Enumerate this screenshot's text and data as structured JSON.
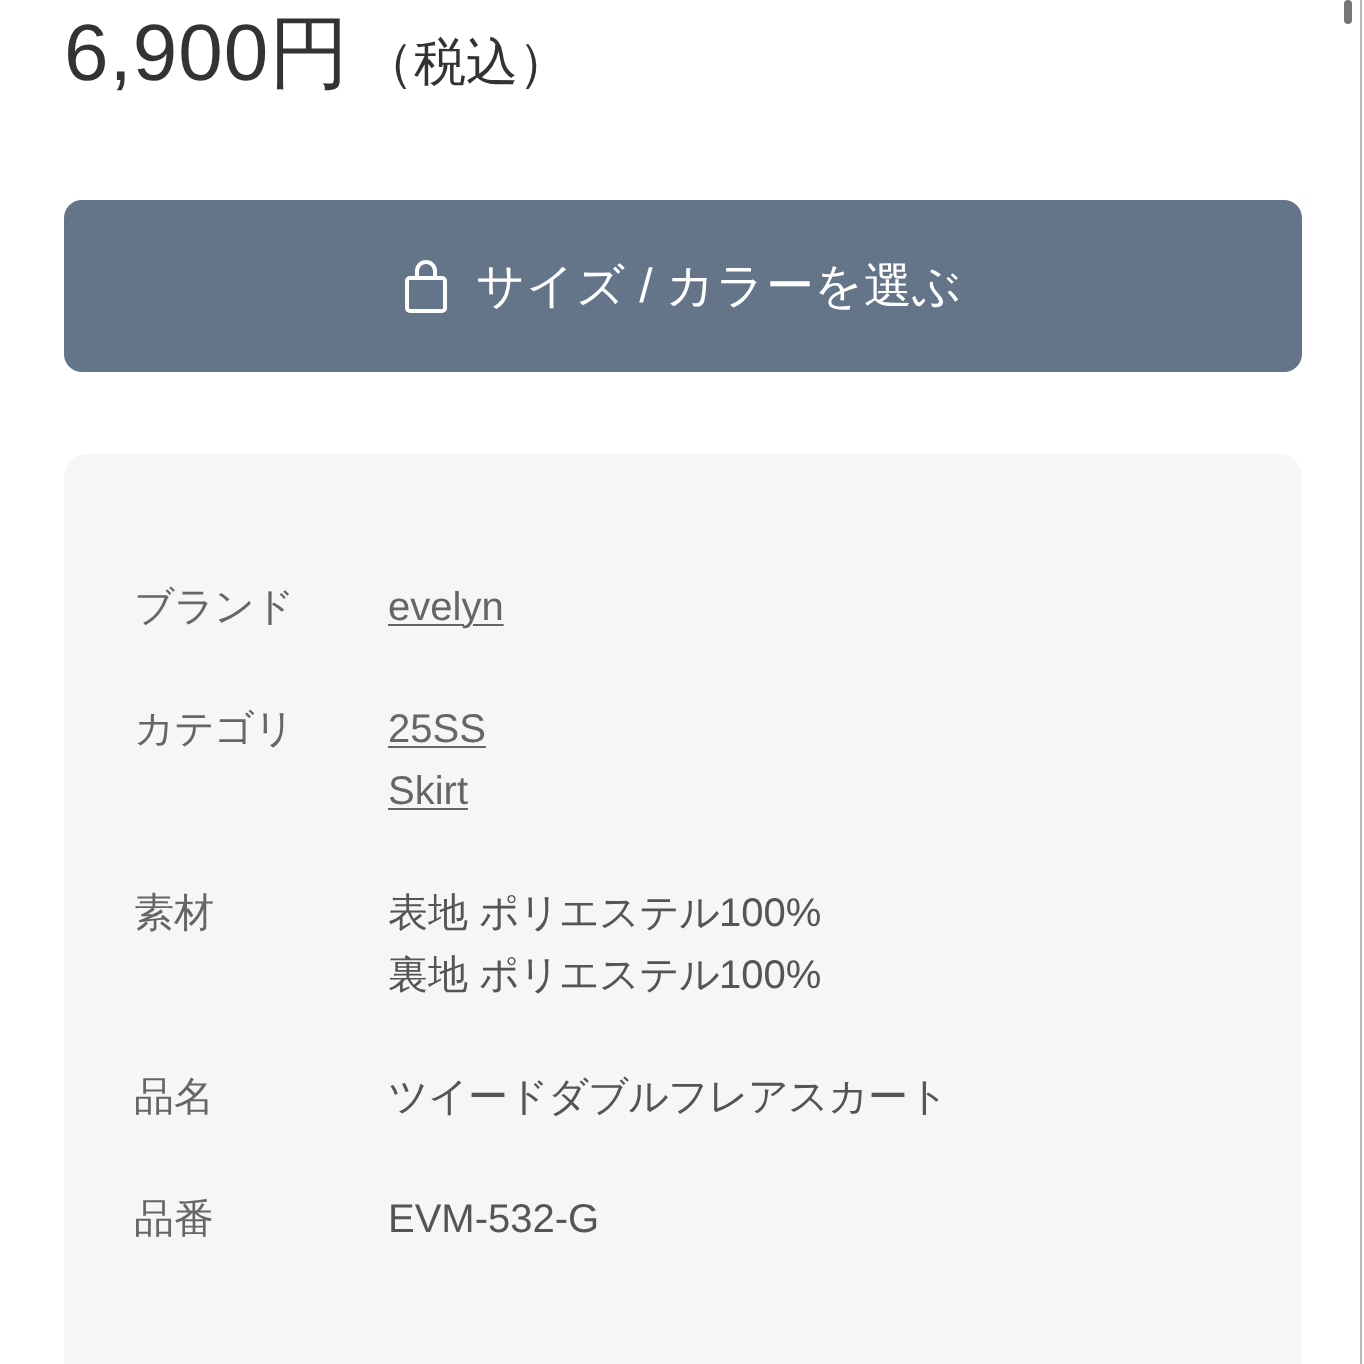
{
  "price": {
    "amount": "6,900円",
    "tax_note": "（税込）"
  },
  "select_button": {
    "label": "サイズ / カラーを選ぶ"
  },
  "details": [
    {
      "label": "ブランド",
      "kind": "links",
      "values": [
        "evelyn"
      ]
    },
    {
      "label": "カテゴリ",
      "kind": "links",
      "values": [
        "25SS",
        "Skirt"
      ]
    },
    {
      "label": "素材",
      "kind": "text",
      "values": [
        "表地 ポリエステル100%",
        "裏地 ポリエステル100%"
      ]
    },
    {
      "label": "品名",
      "kind": "text",
      "values": [
        "ツイードダブルフレアスカート"
      ]
    },
    {
      "label": "品番",
      "kind": "text",
      "values": [
        "EVM-532-G"
      ]
    }
  ]
}
